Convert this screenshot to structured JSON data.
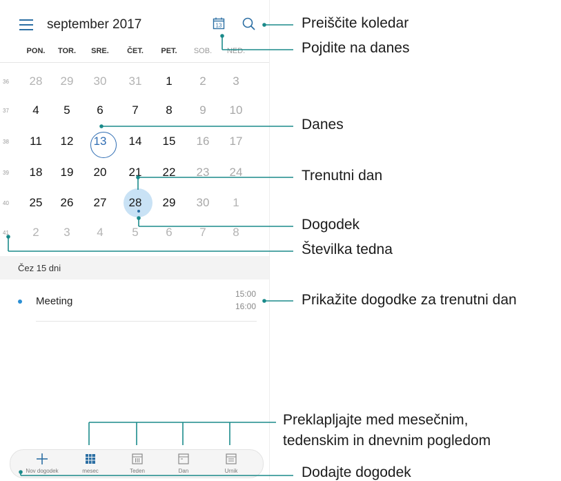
{
  "header": {
    "title": "september 2017"
  },
  "weekdays": [
    "PON.",
    "TOR.",
    "SRE.",
    "ČET.",
    "PET.",
    "SOB.",
    "NED."
  ],
  "weeks": [
    {
      "num": "36",
      "days": [
        "28",
        "29",
        "30",
        "31",
        "1",
        "2",
        "3"
      ]
    },
    {
      "num": "37",
      "days": [
        "4",
        "5",
        "6",
        "7",
        "8",
        "9",
        "10"
      ]
    },
    {
      "num": "38",
      "days": [
        "11",
        "12",
        "13",
        "14",
        "15",
        "16",
        "17"
      ]
    },
    {
      "num": "39",
      "days": [
        "18",
        "19",
        "20",
        "21",
        "22",
        "23",
        "24"
      ]
    },
    {
      "num": "40",
      "days": [
        "25",
        "26",
        "27",
        "28",
        "29",
        "30",
        "1"
      ]
    },
    {
      "num": "41",
      "days": [
        "2",
        "3",
        "4",
        "5",
        "6",
        "7",
        "8"
      ]
    }
  ],
  "agenda": {
    "section": "Čez 15 dni",
    "events": [
      {
        "title": "Meeting",
        "start": "15:00",
        "end": "16:00"
      }
    ]
  },
  "nav": {
    "new_event": "Nov dogodek",
    "month": "mesec",
    "week": "Teden",
    "day": "Dan",
    "schedule": "Urnik"
  },
  "annotations": {
    "search": "Preiščite koledar",
    "goto_today": "Pojdite na danes",
    "today": "Danes",
    "current_day": "Trenutni dan",
    "event": "Dogodek",
    "week_number": "Številka tedna",
    "show_events": "Prikažite dogodke za trenutni dan",
    "switch_views_1": "Preklapljajte med mesečnim,",
    "switch_views_2": "tedenskim in dnevnim pogledom",
    "add_event": "Dodajte dogodek"
  },
  "colors": {
    "accent": "#2b6ea3",
    "selected_fill": "#c9e2f5",
    "event_dot": "#2b8fd4",
    "callout_line": "#1a8a8a"
  }
}
